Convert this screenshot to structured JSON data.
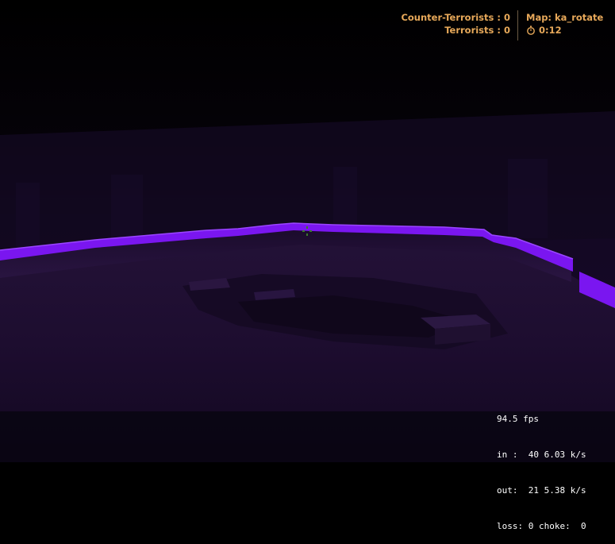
{
  "scoreboard": {
    "ct_label": "Counter-Terrorists :",
    "ct_score": "0",
    "t_label": "Terrorists :",
    "t_score": "0"
  },
  "map": {
    "label": "Map: ka_rotate",
    "timer": "0:12",
    "timer_icon": "stopwatch-icon"
  },
  "netgraph": {
    "fps": "94.5 fps",
    "in_line": "in :  40 6.03 k/s",
    "out_line": "out:  21 5.38 k/s",
    "loss_line": "loss: 0 choke:  0"
  },
  "colors": {
    "hud_text": "#e7a85a",
    "neon_wall": "#7a16f0",
    "ambient": "#1c0b30"
  }
}
